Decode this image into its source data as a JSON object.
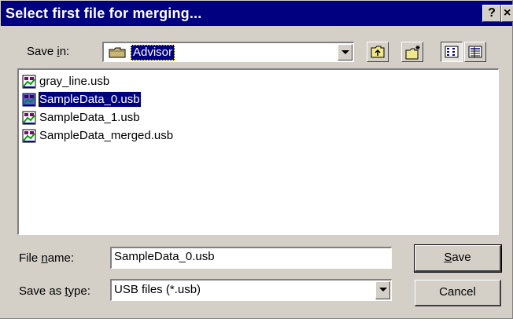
{
  "dialog": {
    "title": "Select first file for merging...",
    "help_glyph": "?",
    "close_glyph": "×"
  },
  "save_in": {
    "label_prefix": "Save ",
    "label_underlined": "i",
    "label_suffix": "n:",
    "value": "Advisor"
  },
  "toolbar": {
    "icons": [
      "up-one-level-icon",
      "create-new-folder-icon",
      "list-view-icon",
      "details-view-icon"
    ]
  },
  "files": [
    {
      "name": "gray_line.usb",
      "selected": false
    },
    {
      "name": "SampleData_0.usb",
      "selected": true
    },
    {
      "name": "SampleData_1.usb",
      "selected": false
    },
    {
      "name": "SampleData_merged.usb",
      "selected": false
    }
  ],
  "filename": {
    "label_prefix": "File ",
    "label_underlined": "n",
    "label_suffix": "ame:",
    "value": "SampleData_0.usb"
  },
  "filetype": {
    "label_prefix": "Save as ",
    "label_underlined": "t",
    "label_suffix": "ype:",
    "value": "USB files (*.usb)"
  },
  "buttons": {
    "save_underlined": "S",
    "save_rest": "ave",
    "cancel": "Cancel"
  }
}
